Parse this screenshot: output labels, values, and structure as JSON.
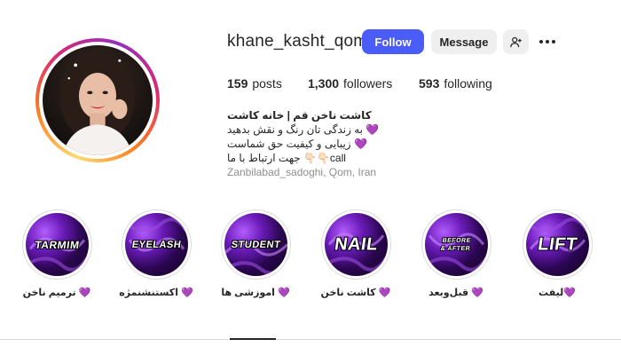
{
  "profile": {
    "username": "khane_kasht_qom",
    "follow_label": "Follow",
    "message_label": "Message",
    "add_user_icon": "add-person-icon",
    "more_icon": "more-horizontal-icon"
  },
  "stats": {
    "posts_count": "159",
    "posts_label": "posts",
    "followers_count": "1,300",
    "followers_label": "followers",
    "following_count": "593",
    "following_label": "following"
  },
  "bio": {
    "name": "کاشت ناخن قم | خانه کاشت",
    "line1": "به زندگی تان رنگ و نقش بدهید 💜",
    "line2": "زیبایی و کیفیت حق شماست 💜",
    "line3": "جهت ارتباط با ما 👇🏻👇🏻call",
    "location": "Zanbilabad_sadoghi, Qom, Iran"
  },
  "highlights": [
    {
      "cover_text": "TARMIM",
      "label": "ترمیم ناخن 💜"
    },
    {
      "cover_text": "EYELASH",
      "label": "اکستنشنمژه 💜"
    },
    {
      "cover_text": "STUDENT",
      "label": "اموزشی ها 💜"
    },
    {
      "cover_text": "NAIL",
      "label": "کاشت ناخن 💜"
    },
    {
      "cover_text": "BEFORE & AFTER",
      "label": "قبل‌وبعد 💜"
    },
    {
      "cover_text": "LIFT",
      "label": "لیفت💜"
    }
  ],
  "colors": {
    "follow_button": "#4a5df9",
    "secondary_button": "#efefef",
    "highlight_purple": "#6a1bb8"
  }
}
